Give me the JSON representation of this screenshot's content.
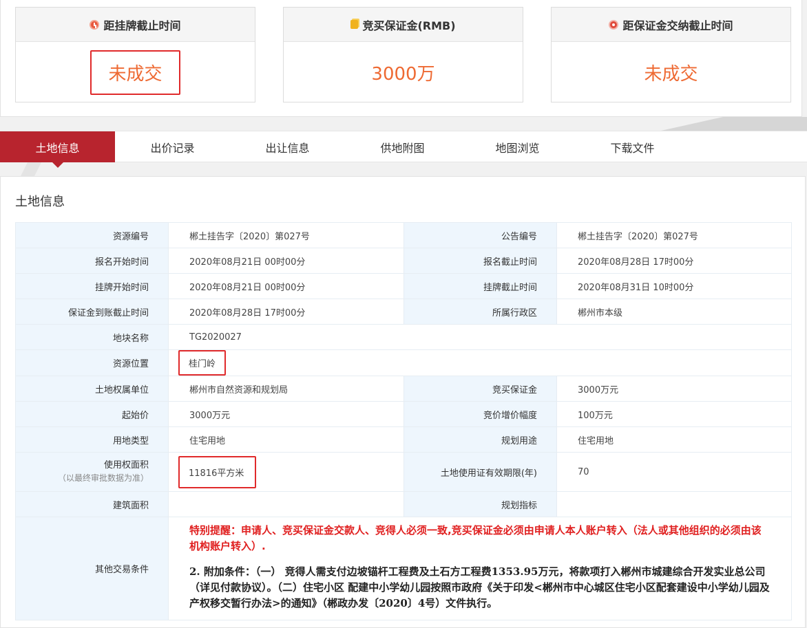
{
  "stats": [
    {
      "icon": "clock-icon",
      "title": "距挂牌截止时间",
      "value": "未成交"
    },
    {
      "icon": "coin-icon",
      "title": "竞买保证金(RMB)",
      "value": "3000万"
    },
    {
      "icon": "alarm-icon",
      "title": "距保证金交纳截止时间",
      "value": "未成交"
    }
  ],
  "tabs": [
    "土地信息",
    "出价记录",
    "出让信息",
    "供地附图",
    "地图浏览",
    "下载文件"
  ],
  "section_title": "土地信息",
  "rows": {
    "r1": {
      "l1": "资源编号",
      "v1": "郴土挂告字〔2020〕第027号",
      "l2": "公告编号",
      "v2": "郴土挂告字〔2020〕第027号"
    },
    "r2": {
      "l1": "报名开始时间",
      "v1": "2020年08月21日 00时00分",
      "l2": "报名截止时间",
      "v2": "2020年08月28日 17时00分"
    },
    "r3": {
      "l1": "挂牌开始时间",
      "v1": "2020年08月21日 00时00分",
      "l2": "挂牌截止时间",
      "v2": "2020年08月31日 10时00分"
    },
    "r4": {
      "l1": "保证金到账截止时间",
      "v1": "2020年08月28日 17时00分",
      "l2": "所属行政区",
      "v2": "郴州市本级"
    },
    "r5": {
      "l1": "地块名称",
      "v1": "TG2020027"
    },
    "r6": {
      "l1": "资源位置",
      "v1": "桂门岭"
    },
    "r7": {
      "l1": "土地权属单位",
      "v1": "郴州市自然资源和规划局",
      "l2": "竞买保证金",
      "v2": "3000万元"
    },
    "r8": {
      "l1": "起始价",
      "v1": "3000万元",
      "l2": "竞价增价幅度",
      "v2": "100万元"
    },
    "r9": {
      "l1": "用地类型",
      "v1": "住宅用地",
      "l2": "规划用途",
      "v2": "住宅用地"
    },
    "r10": {
      "l1": "使用权面积",
      "l1_note": "（以最终审批数据为准）",
      "v1": "11816平方米",
      "l2": "土地使用证有效期限(年)",
      "v2": "70"
    },
    "r11": {
      "l1": "建筑面积",
      "v1": "",
      "l2": "规划指标",
      "v2": ""
    },
    "r12": {
      "l1": "其他交易条件",
      "notice": "特别提醒：申请人、竞买保证金交款人、竞得人必须一致,竞买保证金必须由申请人本人账户转入（法人或其他组织的必须由该机构账户转入）.",
      "condition": "2. 附加条件：（一） 竞得人需支付边坡锚杆工程费及土石方工程费1353.95万元，将款项打入郴州市城建综合开发实业总公司（详见付款协议）。（二）住宅小区 配建中小学幼儿园按照市政府《关于印发<郴州市中心城区住宅小区配套建设中小学幼儿园及产权移交暂行办法>的通知》（郴政办发〔2020〕4号）文件执行。"
    }
  }
}
